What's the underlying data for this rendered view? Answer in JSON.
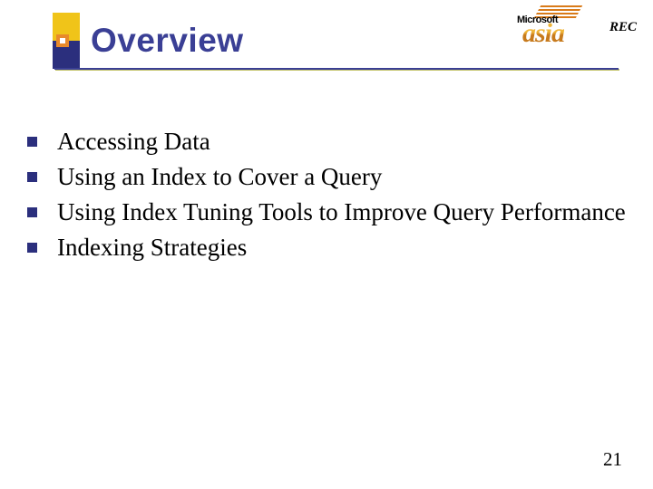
{
  "header": {
    "title": "Overview",
    "logo_ms": "Microsoft",
    "logo_asia": "asia",
    "rec": "REC"
  },
  "bullets": [
    "Accessing Data",
    "Using an Index to Cover a Query",
    "Using Index Tuning Tools to Improve Query Performance",
    "Indexing Strategies"
  ],
  "page_number": "21"
}
